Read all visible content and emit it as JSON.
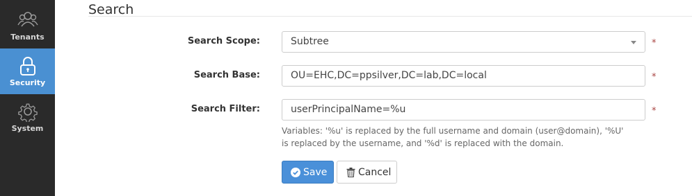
{
  "sidebar": {
    "items": [
      {
        "label": "Tenants",
        "icon": "users-icon",
        "active": false
      },
      {
        "label": "Security",
        "icon": "lock-icon",
        "active": true
      },
      {
        "label": "System",
        "icon": "gear-icon",
        "active": false
      }
    ]
  },
  "section": {
    "title": "Search"
  },
  "form": {
    "scope": {
      "label": "Search Scope:",
      "value": "Subtree"
    },
    "base": {
      "label": "Search Base:",
      "value": "OU=EHC,DC=ppsilver,DC=lab,DC=local"
    },
    "filter": {
      "label": "Search Filter:",
      "value": "userPrincipalName=%u"
    },
    "required_mark": "*",
    "help_text": "Variables: '%u' is replaced by the full username and domain (user@domain), '%U' is replaced by the username, and '%d' is replaced with the domain."
  },
  "actions": {
    "save_label": "Save",
    "cancel_label": "Cancel"
  },
  "colors": {
    "sidebar_bg": "#2a2a2a",
    "active_bg": "#4a90d2",
    "primary": "#4a90d9",
    "required": "#a94442"
  }
}
